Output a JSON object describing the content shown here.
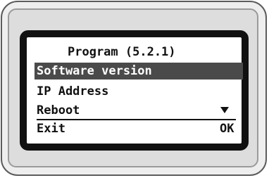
{
  "screen": {
    "title": "Program (5.2.1)",
    "menu_items": [
      {
        "label": "Software version",
        "selected": true
      },
      {
        "label": "IP Address",
        "selected": false
      },
      {
        "label": "Reboot",
        "selected": false
      }
    ],
    "scroll_indicator_icon": "down-triangle-icon",
    "softkeys": {
      "left": "Exit",
      "right": "OK"
    }
  },
  "colors": {
    "selection_background": "#4a4a4a",
    "lcd_background": "#ffffff",
    "lcd_border": "#111111",
    "device_body": "#eeeeee"
  }
}
